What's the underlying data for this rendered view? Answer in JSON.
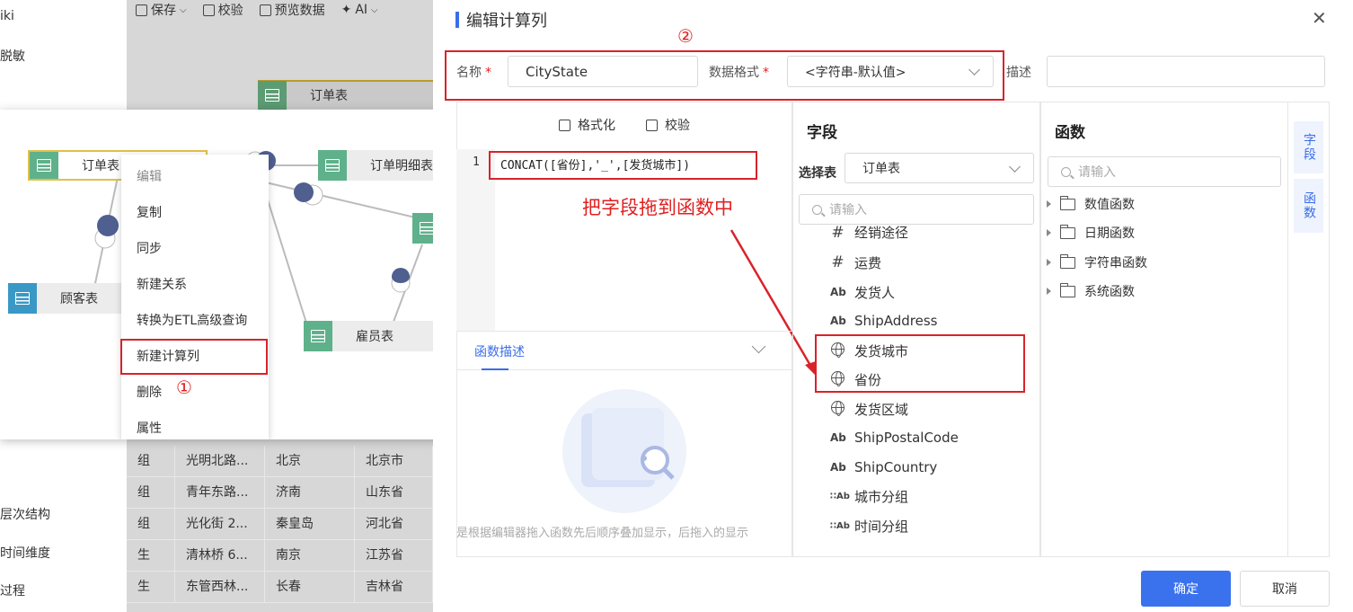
{
  "left_nav": {
    "items": [
      "iki",
      "脱敏",
      "层次结构",
      "时间维度",
      "过程"
    ]
  },
  "toolbar": {
    "save": "保存",
    "validate": "校验",
    "preview": "预览数据",
    "ai": "AI"
  },
  "background_node": {
    "label": "订单表"
  },
  "background_table": {
    "rows": [
      [
        "组",
        "光明北路...",
        "北京",
        "北京市"
      ],
      [
        "组",
        "青年东路...",
        "济南",
        "山东省"
      ],
      [
        "组",
        "光化街 2...",
        "秦皇岛",
        "河北省"
      ],
      [
        "生",
        "清林桥 6...",
        "南京",
        "江苏省"
      ],
      [
        "生",
        "东管西林...",
        "长春",
        "吉林省"
      ]
    ]
  },
  "diagram": {
    "nodes": {
      "orders": "订单表",
      "order_details": "订单明细表",
      "customers": "顾客表",
      "employees": "雇员表"
    },
    "node_colors": {
      "green": "#5fb18b",
      "teal": "#3a98c6"
    },
    "context_menu": [
      "编辑",
      "复制",
      "同步",
      "新建关系",
      "转换为ETL高级查询",
      "新建计算列",
      "删除",
      "属性"
    ],
    "step1_marker": "①"
  },
  "dialog": {
    "title": "编辑计算列",
    "step2_marker": "②",
    "form": {
      "name_label": "名称",
      "name_value": "CityState",
      "format_label": "数据格式",
      "format_value": "<字符串-默认值>",
      "desc_label": "描述",
      "desc_value": "",
      "required_mark": "*"
    },
    "editor": {
      "format_button": "格式化",
      "validate_button": "校验",
      "line_number": "1",
      "code": "CONCAT([省份],'_',[发货城市])",
      "func_desc_tab": "函数描述",
      "empty_hint": "是根据编辑器拖入函数先后顺序叠加显示，后拖入的显示"
    },
    "annotation": "把字段拖到函数中",
    "fields": {
      "title": "字段",
      "select_label": "选择表",
      "select_value": "订单表",
      "search_placeholder": "请输入",
      "items": [
        {
          "icon": "number-icon",
          "label": "经销途径"
        },
        {
          "icon": "number-icon",
          "label": "运费"
        },
        {
          "icon": "text-icon",
          "label": "发货人"
        },
        {
          "icon": "text-icon",
          "label": "ShipAddress"
        },
        {
          "icon": "globe-icon",
          "label": "发货城市"
        },
        {
          "icon": "globe-icon",
          "label": "省份"
        },
        {
          "icon": "globe-icon",
          "label": "发货区域"
        },
        {
          "icon": "text-icon",
          "label": "ShipPostalCode"
        },
        {
          "icon": "text-icon",
          "label": "ShipCountry"
        },
        {
          "icon": "group-text-icon",
          "label": "城市分组"
        },
        {
          "icon": "group-text-icon",
          "label": "时间分组"
        }
      ]
    },
    "functions": {
      "title": "函数",
      "search_placeholder": "请输入",
      "categories": [
        "数值函数",
        "日期函数",
        "字符串函数",
        "系统函数"
      ]
    },
    "side_tabs": [
      "字段",
      "函数"
    ],
    "buttons": {
      "ok": "确定",
      "cancel": "取消"
    },
    "accent_color": "#3a72ee",
    "highlight_color": "#d8232a"
  }
}
